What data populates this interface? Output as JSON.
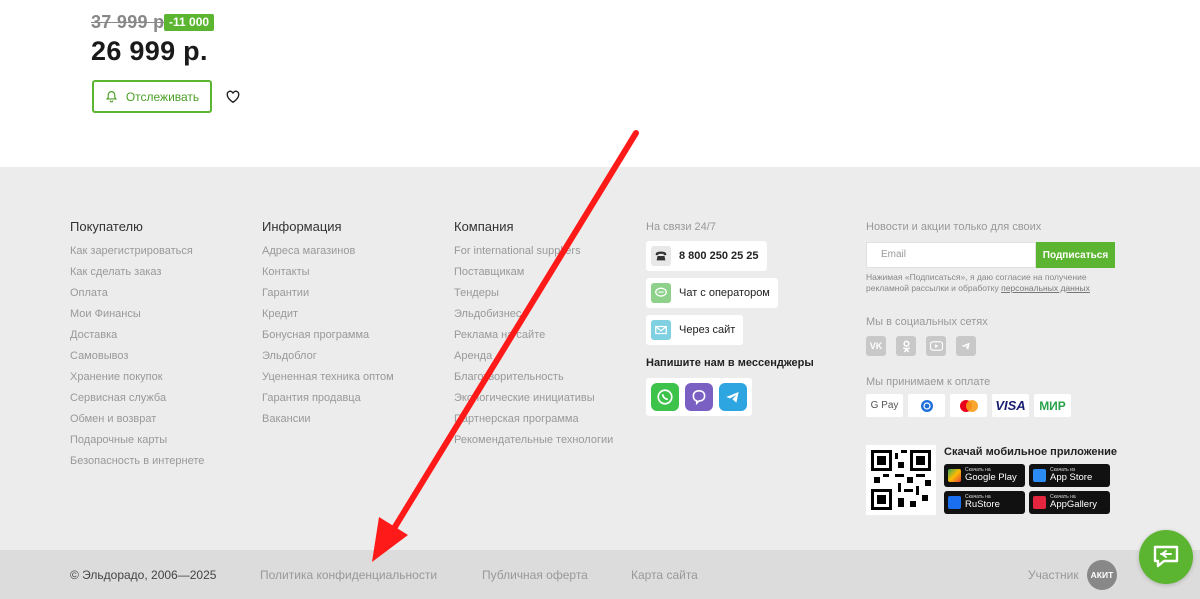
{
  "product": {
    "old_price": "37 999 р.",
    "discount": "-11 000",
    "price": "26 999 р.",
    "track_label": "Отслеживать"
  },
  "footer": {
    "buyer": {
      "title": "Покупателю",
      "links": [
        "Как зарегистрироваться",
        "Как сделать заказ",
        "Оплата",
        "Мои Финансы",
        "Доставка",
        "Самовывоз",
        "Хранение покупок",
        "Сервисная служба",
        "Обмен и возврат",
        "Подарочные карты",
        "Безопасность в интернете"
      ]
    },
    "info": {
      "title": "Информация",
      "links": [
        "Адреса магазинов",
        "Контакты",
        "Гарантии",
        "Кредит",
        "Бонусная программа",
        "Эльдоблог",
        "Уцененная техника оптом",
        "Гарантия продавца",
        "Вакансии"
      ]
    },
    "company": {
      "title": "Компания",
      "links": [
        "For international suppliers",
        "Поставщикам",
        "Тендеры",
        "Эльдобизнес",
        "Реклама на сайте",
        "Аренда",
        "Благотворительность",
        "Экологические инициативы",
        "Партнерская программа",
        "Рекомендательные технологии"
      ]
    },
    "contact": {
      "caption": "На связи 24/7",
      "phone": "8 800 250 25 25",
      "chat": "Чат с оператором",
      "site": "Через сайт",
      "messengers_title": "Напишите нам в мессенджеры"
    },
    "news": {
      "caption": "Новости и акции только для своих",
      "email_placeholder": "Email",
      "subscribe": "Подписаться",
      "consent": "Нажимая «Подписаться», я даю согласие на получение рекламной рассылки и обработку",
      "consent_link": "персональных данных",
      "social_caption": "Мы в социальных сетях",
      "pay_caption": "Мы принимаем к оплате",
      "pay_methods": [
        "G Pay",
        "SberPay",
        "Mastercard",
        "VISA",
        "МИР"
      ]
    },
    "app": {
      "title": "Скачай мобильное приложение",
      "stores": [
        {
          "small": "Скачать на",
          "name": "Google Play"
        },
        {
          "small": "Скачать из",
          "name": "App Store"
        },
        {
          "small": "Скачать на",
          "name": "RuStore"
        },
        {
          "small": "Скачать на",
          "name": "AppGallery"
        }
      ]
    }
  },
  "bottom": {
    "copyright": "© Эльдорадо, 2006—2025",
    "privacy": "Политика конфиденциальности",
    "offer": "Публичная оферта",
    "sitemap": "Карта сайта",
    "member": "Участник",
    "akit": "АКИТ"
  },
  "colors": {
    "brand_green": "#5cb531",
    "arrow_red": "#ff1a1a"
  }
}
